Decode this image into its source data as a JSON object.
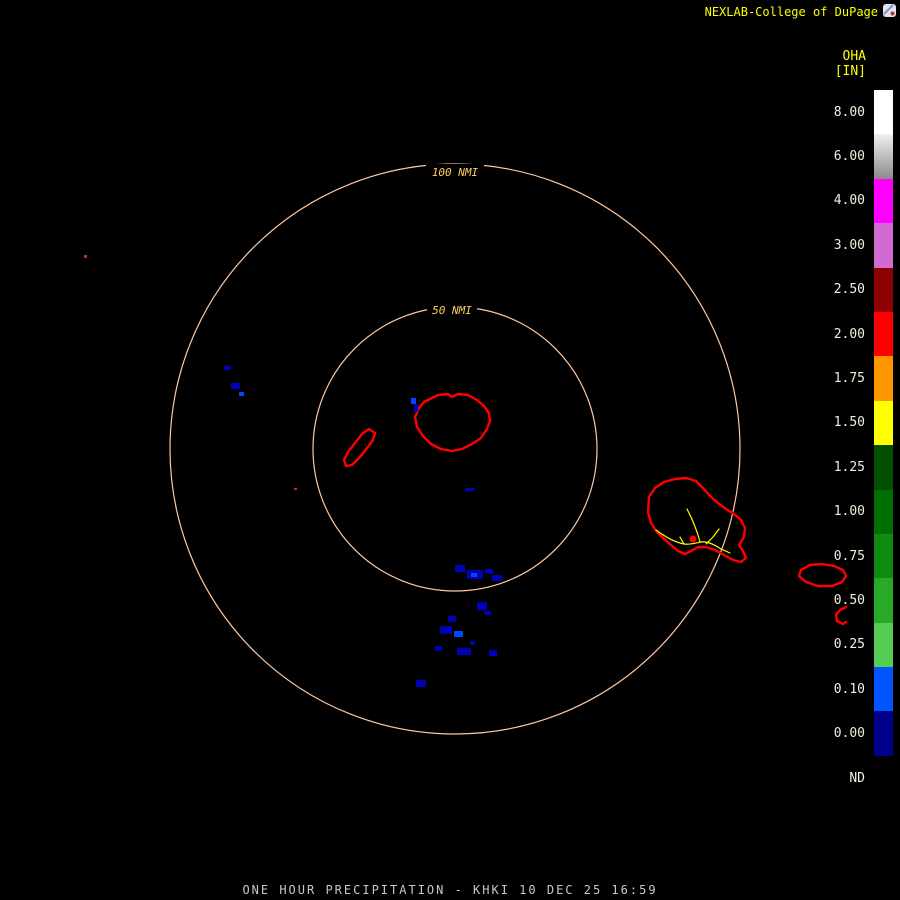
{
  "header": {
    "title": "NEXLAB-College of DuPage"
  },
  "colorbar": {
    "title": "OHA",
    "unit": "[IN]",
    "levels": [
      {
        "label": "8.00",
        "color": "#ffffff"
      },
      {
        "label": "6.00",
        "color": "#b4b4b4",
        "gradient": [
          "#f0f0f0",
          "#8a8a8a"
        ]
      },
      {
        "label": "4.00",
        "color": "#ff00ff"
      },
      {
        "label": "3.00",
        "color": "#d26ad2"
      },
      {
        "label": "2.50",
        "color": "#8c0000"
      },
      {
        "label": "2.00",
        "color": "#ff0000"
      },
      {
        "label": "1.75",
        "color": "#ff9600"
      },
      {
        "label": "1.50",
        "color": "#ffff00"
      },
      {
        "label": "1.25",
        "color": "#005000"
      },
      {
        "label": "1.00",
        "color": "#006e00"
      },
      {
        "label": "0.75",
        "color": "#0f8c0f"
      },
      {
        "label": "0.50",
        "color": "#28aa28"
      },
      {
        "label": "0.25",
        "color": "#55cd55"
      },
      {
        "label": "0.10",
        "color": "#0055ff"
      },
      {
        "label": "0.00",
        "color": "#00008c"
      },
      {
        "label": "ND",
        "color": "#000000"
      }
    ]
  },
  "radar": {
    "ring_labels": {
      "outer": "100 NMI",
      "inner": "50 NMI"
    }
  },
  "footer": {
    "caption": "ONE HOUR PRECIPITATION - KHKI 10 DEC 25 16:59"
  },
  "colors": {
    "background": "#000000",
    "accent_yellow": "#ffff00",
    "ring": "#ffc8a0",
    "ring_label": "#ffd060",
    "island": "#ff0000",
    "road": "#ffff00",
    "echo_navy": "#0000b4",
    "echo_blue": "#0046ff",
    "caption": "#c8c8c8",
    "legend_text": "#f0efe0"
  }
}
